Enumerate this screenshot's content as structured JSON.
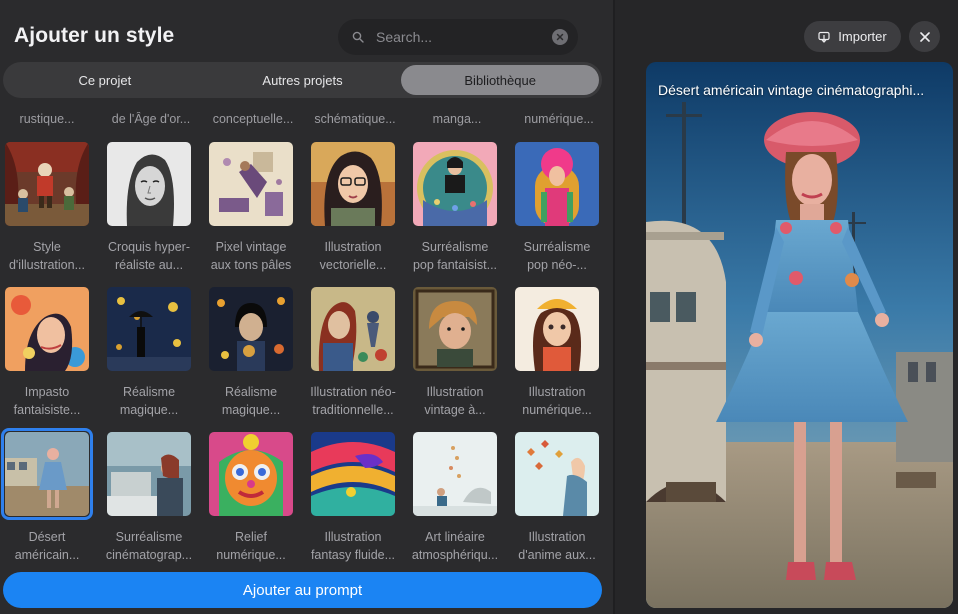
{
  "header": {
    "title": "Ajouter un style",
    "search_placeholder": "Search..."
  },
  "tabs": [
    {
      "label": "Ce projet",
      "active": false
    },
    {
      "label": "Autres projets",
      "active": false
    },
    {
      "label": "Bibliothèque",
      "active": true
    }
  ],
  "cutoff_labels": [
    "rustique...",
    "de l'Âge d'or...",
    "conceptuelle...",
    "schématique...",
    "manga...",
    "numérique..."
  ],
  "styles": [
    {
      "line1": "Style",
      "line2": "d'illustration...",
      "thumb": "theater"
    },
    {
      "line1": "Croquis hyper-",
      "line2": "réaliste au...",
      "thumb": "sketch"
    },
    {
      "line1": "Pixel vintage",
      "line2": "aux tons pâles",
      "thumb": "pixel"
    },
    {
      "line1": "Illustration",
      "line2": "vectorielle...",
      "thumb": "vector"
    },
    {
      "line1": "Surréalisme",
      "line2": "pop fantaisist...",
      "thumb": "popcircle"
    },
    {
      "line1": "Surréalisme",
      "line2": "pop néo-...",
      "thumb": "popneo"
    },
    {
      "line1": "Impasto",
      "line2": "fantaisiste...",
      "thumb": "impasto"
    },
    {
      "line1": "Réalisme",
      "line2": "magique...",
      "thumb": "magic1"
    },
    {
      "line1": "Réalisme",
      "line2": "magique...",
      "thumb": "magic2"
    },
    {
      "line1": "Illustration néo-",
      "line2": "traditionnelle...",
      "thumb": "neotrad"
    },
    {
      "line1": "Illustration",
      "line2": "vintage à...",
      "thumb": "vintageboy"
    },
    {
      "line1": "Illustration",
      "line2": "numérique...",
      "thumb": "digitalgirl"
    },
    {
      "line1": "Désert",
      "line2": "américain...",
      "thumb": "desert",
      "selected": true
    },
    {
      "line1": "Surréalisme",
      "line2": "cinématograp...",
      "thumb": "cinema"
    },
    {
      "line1": "Relief",
      "line2": "numérique...",
      "thumb": "relief"
    },
    {
      "line1": "Illustration",
      "line2": "fantasy fluide...",
      "thumb": "fluid"
    },
    {
      "line1": "Art linéaire",
      "line2": "atmosphériqu...",
      "thumb": "lineart"
    },
    {
      "line1": "Illustration",
      "line2": "d'anime aux...",
      "thumb": "anime"
    }
  ],
  "add_button": "Ajouter au prompt",
  "right": {
    "import_label": "Importer",
    "preview_title": "Désert américain vintage cinématographi..."
  },
  "colors": {
    "accent": "#1b84f3",
    "selected_ring": "#2f80ed",
    "panel_bg": "#2b2b2d"
  },
  "icons": {
    "search": "search-icon",
    "clear": "clear-icon",
    "import": "import-icon",
    "close": "close-icon"
  }
}
